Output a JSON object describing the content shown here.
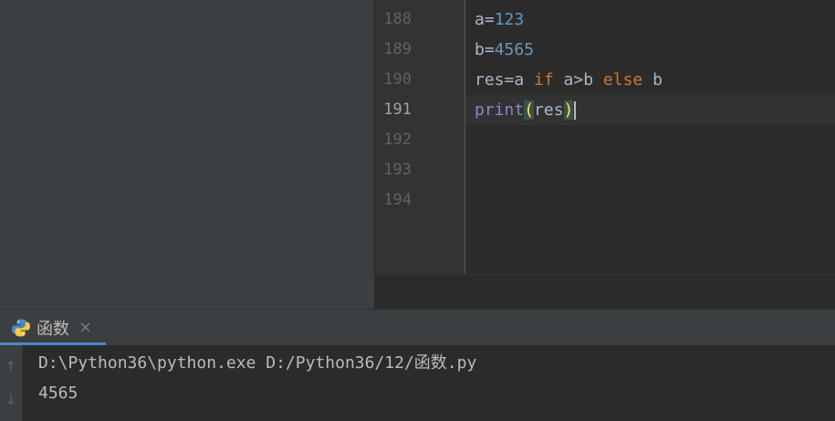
{
  "editor": {
    "line_numbers": [
      "188",
      "189",
      "190",
      "191",
      "192",
      "193",
      "194"
    ],
    "current_line": "191",
    "code": {
      "line188": {
        "var": "a",
        "op": "=",
        "value": "123"
      },
      "line189": {
        "var": "b",
        "op": "=",
        "value": "4565"
      },
      "line190": {
        "lhs": "res=a ",
        "kw_if": "if",
        "cond": " a>b ",
        "kw_else": "else",
        "tail": " b"
      },
      "line191": {
        "fn": "print",
        "open_paren": "(",
        "arg": "res",
        "close_paren": ")"
      }
    }
  },
  "run_panel": {
    "tab_label": "函数",
    "tab_close": "×",
    "tab_icon": "python-icon",
    "toolbar_icons": [
      "arrow-up-icon",
      "arrow-down-icon"
    ],
    "console_lines": [
      "D:\\Python36\\python.exe D:/Python36/12/函数.py",
      "4565"
    ]
  },
  "colors": {
    "background": "#2b2b2b",
    "panel": "#3c3f41",
    "number": "#6897bb",
    "keyword": "#cc7832",
    "builtin": "#8888c6",
    "brace_match": "#ffef28",
    "tab_underline": "#4a88c7"
  }
}
